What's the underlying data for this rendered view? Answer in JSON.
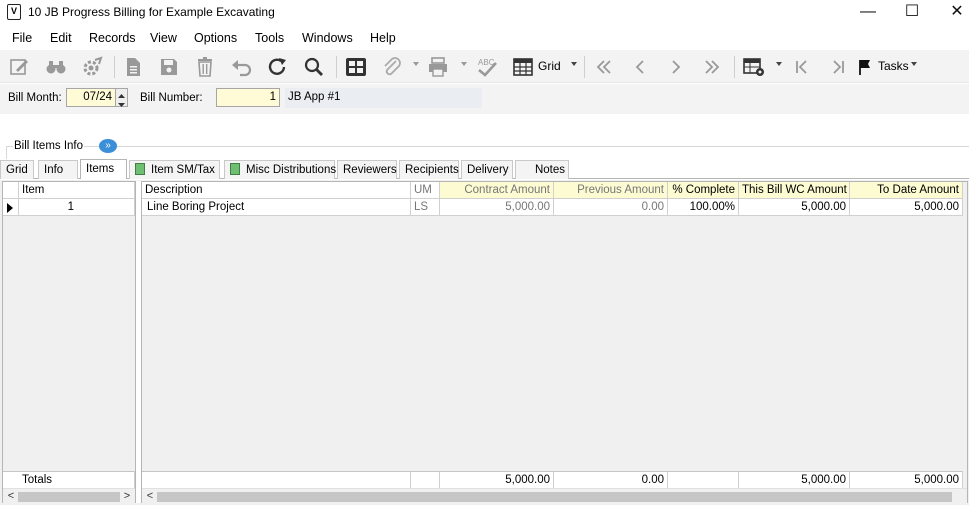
{
  "window": {
    "title": "10 JB Progress Billing for Example Excavating",
    "controls": {
      "minimize": "—",
      "maximize": "☐",
      "close": "✕"
    }
  },
  "menu": [
    "File",
    "Edit",
    "Records",
    "View",
    "Options",
    "Tools",
    "Windows",
    "Help"
  ],
  "toolbar": {
    "grid_label": "Grid",
    "tasks_label": "Tasks",
    "icons": [
      "edit-icon",
      "binoculars-icon",
      "gear-icon",
      "document-icon",
      "save-icon",
      "delete-icon",
      "undo-icon",
      "refresh-icon",
      "search-icon",
      "grid-view-icon",
      "attach-icon",
      "print-icon",
      "spellcheck-icon",
      "table-icon",
      "first-icon",
      "previous-icon",
      "next-icon",
      "last-icon",
      "table-settings-icon",
      "first-record-icon",
      "last-record-icon",
      "flag-icon"
    ]
  },
  "form": {
    "bill_month_label": "Bill Month:",
    "bill_month_value": "07/24",
    "bill_number_label": "Bill Number:",
    "bill_number_value": "1",
    "bill_description": "JB App #1"
  },
  "section": {
    "label": "Bill Items Info"
  },
  "tabs": [
    "Grid",
    "Info",
    "Items",
    "Item SM/Tax",
    "Misc Distributions",
    "Reviewers",
    "Recipients",
    "Delivery",
    "Notes"
  ],
  "active_tab": "Items",
  "left_grid": {
    "header": "Item",
    "rows": [
      "1"
    ],
    "totals_label": "Totals"
  },
  "grid": {
    "columns": [
      "Description",
      "UM",
      "Contract Amount",
      "Previous Amount",
      "% Complete",
      "This Bill WC Amount",
      "To Date Amount"
    ],
    "rows": [
      {
        "description": "Line Boring Project",
        "um": "LS",
        "contract_amount": "5,000.00",
        "previous_amount": "0.00",
        "pct_complete": "100.00%",
        "this_bill_wc_amount": "5,000.00",
        "to_date_amount": "5,000.00"
      }
    ],
    "totals": {
      "contract_amount": "5,000.00",
      "previous_amount": "0.00",
      "this_bill_wc_amount": "5,000.00",
      "to_date_amount": "5,000.00"
    }
  },
  "colors": {
    "required_field": "#fefbd6",
    "accent": "#3a8fd8"
  }
}
